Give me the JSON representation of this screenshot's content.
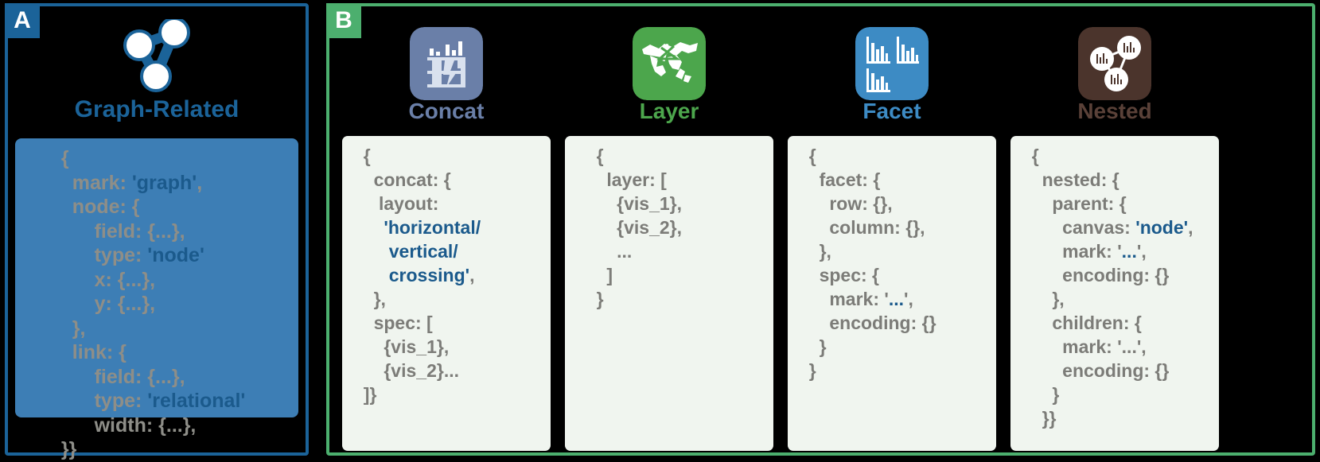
{
  "panels": {
    "a": {
      "badge": "A",
      "title": "Graph-Related",
      "title_color": "#1b6399",
      "icon": "graph-node-link-icon",
      "border_color": "#1b6399",
      "code_bg": "#3d7eb5",
      "code_lines": [
        {
          "indent": 1,
          "parts": [
            {
              "t": "{",
              "c": "key"
            }
          ]
        },
        {
          "indent": 2,
          "parts": [
            {
              "t": "mark: ",
              "c": "key"
            },
            {
              "t": "'graph'",
              "c": "str"
            },
            {
              "t": ",",
              "c": "key"
            }
          ]
        },
        {
          "indent": 2,
          "parts": [
            {
              "t": "node: {",
              "c": "key"
            }
          ]
        },
        {
          "indent": 4,
          "parts": [
            {
              "t": "field: {...},",
              "c": "key"
            }
          ]
        },
        {
          "indent": 4,
          "parts": [
            {
              "t": "type: ",
              "c": "key"
            },
            {
              "t": "'node'",
              "c": "str"
            }
          ]
        },
        {
          "indent": 4,
          "parts": [
            {
              "t": "x: {...},",
              "c": "key"
            }
          ]
        },
        {
          "indent": 4,
          "parts": [
            {
              "t": "y: {...},",
              "c": "key"
            }
          ]
        },
        {
          "indent": 2,
          "parts": [
            {
              "t": "},",
              "c": "key"
            }
          ]
        },
        {
          "indent": 2,
          "parts": [
            {
              "t": "link: {",
              "c": "key"
            }
          ]
        },
        {
          "indent": 4,
          "parts": [
            {
              "t": "field: {...},",
              "c": "key"
            }
          ]
        },
        {
          "indent": 4,
          "parts": [
            {
              "t": "type: ",
              "c": "key"
            },
            {
              "t": "'relational'",
              "c": "str"
            }
          ]
        },
        {
          "indent": 4,
          "parts": [
            {
              "t": "width: {...},",
              "c": "key"
            }
          ]
        },
        {
          "indent": 1,
          "parts": [
            {
              "t": "}}",
              "c": "key"
            }
          ]
        }
      ]
    },
    "b": {
      "badge": "B",
      "border_color": "#4caf6e",
      "card_bg": "#f0f5ef",
      "columns": [
        {
          "title": "Concat",
          "title_color": "#6a7fa8",
          "icon": "concat-chart-icon",
          "icon_color": "#6a7fa8",
          "code_lines": [
            {
              "indent": 1,
              "parts": [
                {
                  "t": "{",
                  "c": "key"
                }
              ]
            },
            {
              "indent": 2,
              "parts": [
                {
                  "t": "concat: {",
                  "c": "key"
                }
              ]
            },
            {
              "indent": 2,
              "parts": [
                {
                  "t": " layout:",
                  "c": "key"
                }
              ]
            },
            {
              "indent": 2,
              "parts": [
                {
                  "t": "  ",
                  "c": "key"
                },
                {
                  "t": "'horizontal/",
                  "c": "str"
                }
              ]
            },
            {
              "indent": 2,
              "parts": [
                {
                  "t": "   ",
                  "c": "key"
                },
                {
                  "t": "vertical/",
                  "c": "str"
                }
              ]
            },
            {
              "indent": 2,
              "parts": [
                {
                  "t": "   ",
                  "c": "key"
                },
                {
                  "t": "crossing'",
                  "c": "str"
                },
                {
                  "t": ",",
                  "c": "key"
                }
              ]
            },
            {
              "indent": 2,
              "parts": [
                {
                  "t": "},",
                  "c": "key"
                }
              ]
            },
            {
              "indent": 2,
              "parts": [
                {
                  "t": "spec: [",
                  "c": "key"
                }
              ]
            },
            {
              "indent": 3,
              "parts": [
                {
                  "t": "{vis_1},",
                  "c": "key"
                }
              ]
            },
            {
              "indent": 3,
              "parts": [
                {
                  "t": "{vis_2}...",
                  "c": "key"
                }
              ]
            },
            {
              "indent": 1,
              "parts": [
                {
                  "t": "]}",
                  "c": "key"
                }
              ]
            }
          ]
        },
        {
          "title": "Layer",
          "title_color": "#4ca64c",
          "icon": "layer-map-icon",
          "icon_color": "#4ca64c",
          "code_lines": [
            {
              "indent": 2,
              "parts": [
                {
                  "t": "{",
                  "c": "key"
                }
              ]
            },
            {
              "indent": 3,
              "parts": [
                {
                  "t": "layer: [",
                  "c": "key"
                }
              ]
            },
            {
              "indent": 4,
              "parts": [
                {
                  "t": "{vis_1},",
                  "c": "key"
                }
              ]
            },
            {
              "indent": 4,
              "parts": [
                {
                  "t": "{vis_2},",
                  "c": "key"
                }
              ]
            },
            {
              "indent": 4,
              "parts": [
                {
                  "t": "...",
                  "c": "key"
                }
              ]
            },
            {
              "indent": 3,
              "parts": [
                {
                  "t": "]",
                  "c": "key"
                }
              ]
            },
            {
              "indent": 2,
              "parts": [
                {
                  "t": "}",
                  "c": "key"
                }
              ]
            }
          ]
        },
        {
          "title": "Facet",
          "title_color": "#3d8bc4",
          "icon": "facet-small-multiples-icon",
          "icon_color": "#3d8bc4",
          "code_lines": [
            {
              "indent": 1,
              "parts": [
                {
                  "t": "{",
                  "c": "key"
                }
              ]
            },
            {
              "indent": 2,
              "parts": [
                {
                  "t": "facet: {",
                  "c": "key"
                }
              ]
            },
            {
              "indent": 3,
              "parts": [
                {
                  "t": "row: {},",
                  "c": "key"
                }
              ]
            },
            {
              "indent": 3,
              "parts": [
                {
                  "t": "column: {},",
                  "c": "key"
                }
              ]
            },
            {
              "indent": 2,
              "parts": [
                {
                  "t": "},",
                  "c": "key"
                }
              ]
            },
            {
              "indent": 2,
              "parts": [
                {
                  "t": "spec: {",
                  "c": "key"
                }
              ]
            },
            {
              "indent": 3,
              "parts": [
                {
                  "t": "mark: '",
                  "c": "key"
                },
                {
                  "t": "...",
                  "c": "str"
                },
                {
                  "t": "',",
                  "c": "key"
                }
              ]
            },
            {
              "indent": 3,
              "parts": [
                {
                  "t": "encoding: {}",
                  "c": "key"
                }
              ]
            },
            {
              "indent": 2,
              "parts": [
                {
                  "t": "}",
                  "c": "key"
                }
              ]
            },
            {
              "indent": 1,
              "parts": [
                {
                  "t": "}",
                  "c": "key"
                }
              ]
            }
          ]
        },
        {
          "title": "Nested",
          "title_color": "#5a4138",
          "icon": "nested-graph-chart-icon",
          "icon_color": "#4b342c",
          "code_lines": [
            {
              "indent": 1,
              "parts": [
                {
                  "t": "{",
                  "c": "key"
                }
              ]
            },
            {
              "indent": 2,
              "parts": [
                {
                  "t": "nested: {",
                  "c": "key"
                }
              ]
            },
            {
              "indent": 3,
              "parts": [
                {
                  "t": "parent: {",
                  "c": "key"
                }
              ]
            },
            {
              "indent": 4,
              "parts": [
                {
                  "t": "canvas: ",
                  "c": "key"
                },
                {
                  "t": "'node'",
                  "c": "str"
                },
                {
                  "t": ",",
                  "c": "key"
                }
              ]
            },
            {
              "indent": 4,
              "parts": [
                {
                  "t": "mark: '",
                  "c": "key"
                },
                {
                  "t": "...",
                  "c": "str"
                },
                {
                  "t": "',",
                  "c": "key"
                }
              ]
            },
            {
              "indent": 4,
              "parts": [
                {
                  "t": "encoding: {}",
                  "c": "key"
                }
              ]
            },
            {
              "indent": 3,
              "parts": [
                {
                  "t": "},",
                  "c": "key"
                }
              ]
            },
            {
              "indent": 3,
              "parts": [
                {
                  "t": "children: {",
                  "c": "key"
                }
              ]
            },
            {
              "indent": 4,
              "parts": [
                {
                  "t": "mark: '...',",
                  "c": "key"
                }
              ]
            },
            {
              "indent": 4,
              "parts": [
                {
                  "t": "encoding: {}",
                  "c": "key"
                }
              ]
            },
            {
              "indent": 3,
              "parts": [
                {
                  "t": "}",
                  "c": "key"
                }
              ]
            },
            {
              "indent": 2,
              "parts": [
                {
                  "t": "}}",
                  "c": "key"
                }
              ]
            }
          ]
        }
      ]
    }
  }
}
